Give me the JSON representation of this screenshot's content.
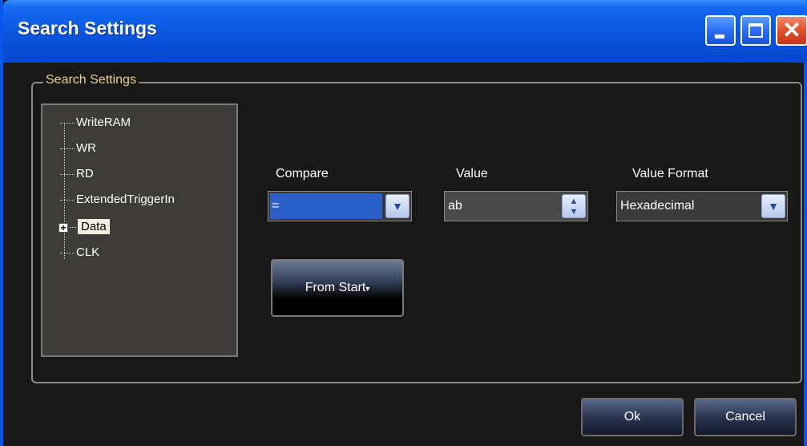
{
  "window": {
    "title": "Search Settings",
    "controls": {
      "minimize_icon": "minimize-icon",
      "maximize_icon": "maximize-icon",
      "close_icon": "close-icon"
    },
    "title_color": "#0a55e0"
  },
  "group": {
    "legend": "Search Settings",
    "legend_color": "#e8d48a"
  },
  "tree": {
    "items": [
      {
        "label": "WriteRAM"
      },
      {
        "label": "WR"
      },
      {
        "label": "RD"
      },
      {
        "label": "ExtendedTriggerIn"
      },
      {
        "label": "Data",
        "selected": true,
        "expander": "+"
      },
      {
        "label": "CLK"
      }
    ]
  },
  "compare": {
    "label": "Compare",
    "value": "=",
    "dropdown_icon": "chevron-down-icon"
  },
  "value": {
    "label": "Value",
    "value": "ab",
    "spinner_icon": "spinner-icon"
  },
  "value_format": {
    "label": "Value Format",
    "value": "Hexadecimal",
    "dropdown_icon": "chevron-down-icon"
  },
  "from_start": {
    "label": "From Start"
  },
  "buttons": {
    "ok": "Ok",
    "cancel": "Cancel"
  }
}
